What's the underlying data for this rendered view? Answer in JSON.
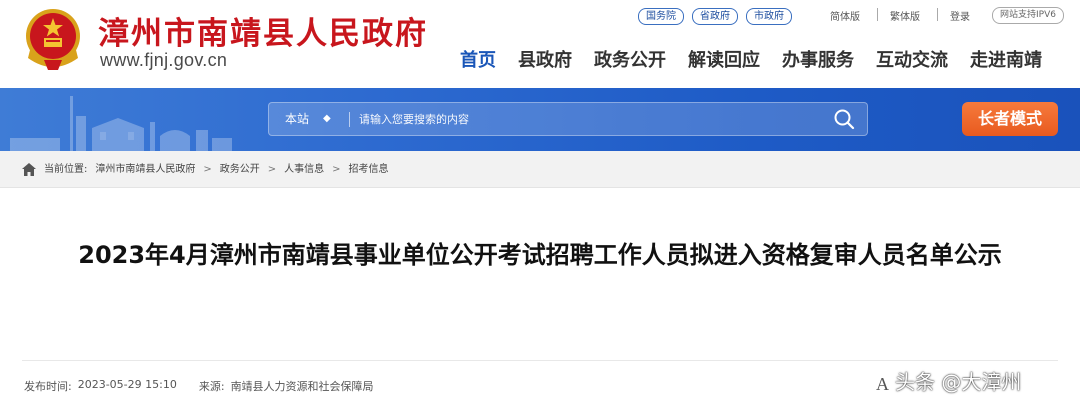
{
  "header": {
    "site_name": "漳州市南靖县人民政府",
    "site_url": "www.fjnj.gov.cn",
    "top_links": [
      "国务院",
      "省政府",
      "市政府"
    ],
    "lang_simplified": "简体版",
    "lang_traditional": "繁体版",
    "login": "登录",
    "ipv6": "网站支持IPV6",
    "emblem_icon": "national-emblem-icon",
    "brand_color": "#c8161d"
  },
  "nav": {
    "items": [
      "首页",
      "县政府",
      "政务公开",
      "解读回应",
      "办事服务",
      "互动交流",
      "走进南靖"
    ],
    "active_index": 0,
    "active_color": "#1a56b8"
  },
  "search": {
    "scope": "本站",
    "placeholder": "请输入您要搜索的内容",
    "icon": "search-icon"
  },
  "elder_mode": "长者模式",
  "breadcrumb": {
    "label": "当前位置:",
    "items": [
      "漳州市南靖县人民政府",
      "政务公开",
      "人事信息",
      "招考信息"
    ]
  },
  "article": {
    "title": "2023年4月漳州市南靖县事业单位公开考试招聘工作人员拟进入资格复审人员名单公示",
    "publish_label": "发布时间:",
    "publish_time": "2023-05-29 15:10",
    "source_label": "来源:",
    "source": "南靖县人力资源和社会保障局",
    "font_size_control": "A"
  },
  "watermark": "头条 @大漳州"
}
